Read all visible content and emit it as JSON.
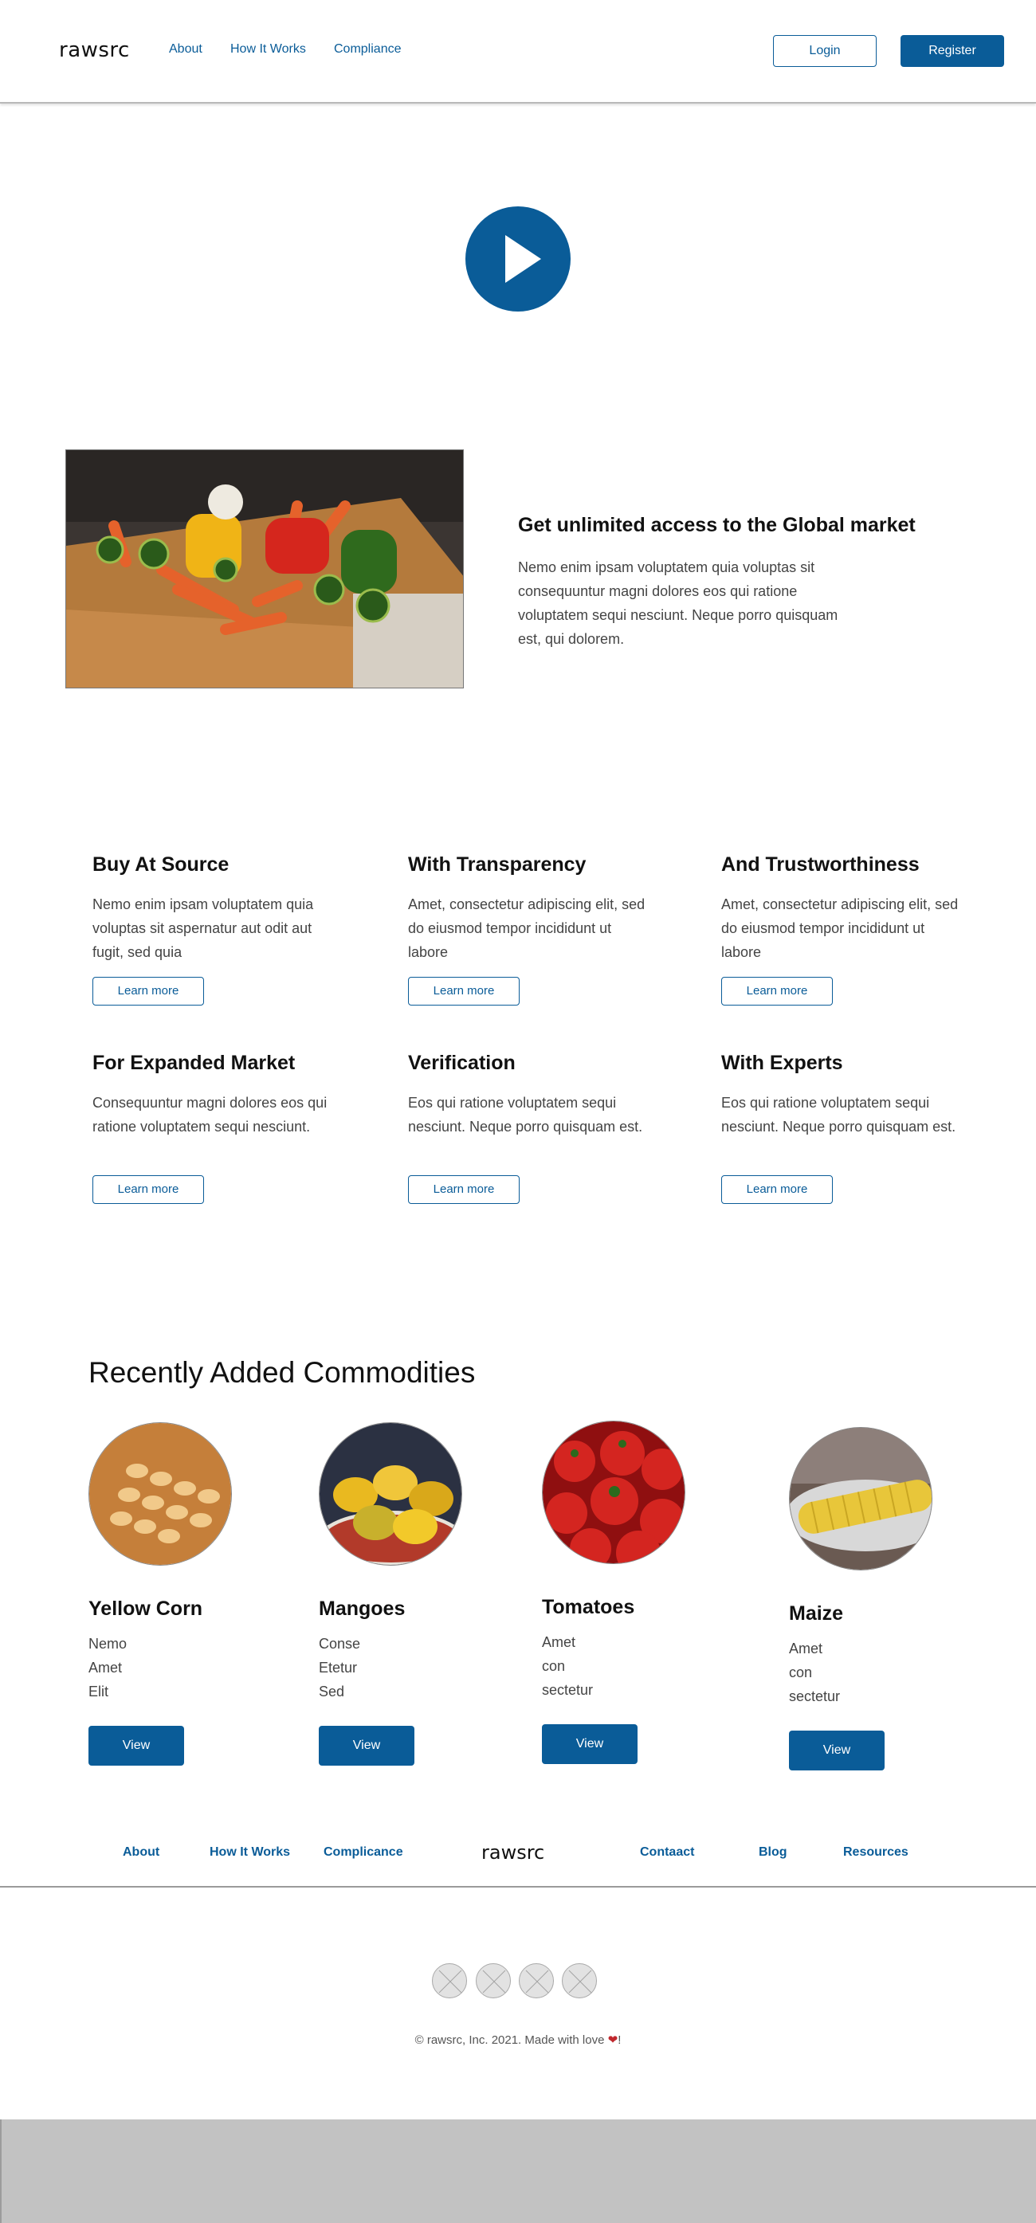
{
  "header": {
    "logo": "rawsrc",
    "nav": [
      "About",
      "How It Works",
      "Compliance"
    ],
    "login_label": "Login",
    "register_label": "Register"
  },
  "hero": {
    "title": "Get unlimited access to the Global market",
    "text": "Nemo enim ipsam voluptatem quia voluptas sit consequuntur magni dolores eos qui ratione voluptatem sequi nesciunt. Neque porro quisquam est, qui dolorem."
  },
  "features": [
    {
      "title": "Buy At Source",
      "text": "Nemo enim ipsam voluptatem quia voluptas sit aspernatur aut odit aut fugit, sed quia",
      "button": "Learn more"
    },
    {
      "title": "With Transparency",
      "text": "Amet, consectetur adipiscing elit, sed do eiusmod tempor incididunt ut labore",
      "button": "Learn more"
    },
    {
      "title": "And Trustworthiness",
      "text": "Amet, consectetur adipiscing elit, sed do eiusmod tempor incididunt ut labore",
      "button": "Learn more"
    },
    {
      "title": "For Expanded Market",
      "text": "Consequuntur magni dolores eos qui ratione voluptatem sequi nesciunt.",
      "button": "Learn more"
    },
    {
      "title": "Verification",
      "text": "Eos qui ratione voluptatem sequi nesciunt. Neque porro quisquam est.",
      "button": "Learn more"
    },
    {
      "title": "With Experts",
      "text": "Eos qui ratione voluptatem sequi nesciunt. Neque porro quisquam est.",
      "button": "Learn more"
    }
  ],
  "commodities": {
    "title": "Recently Added Commodities",
    "items": [
      {
        "name": "Yellow Corn",
        "lines": [
          "Nemo",
          "Amet",
          "Elit"
        ],
        "button": "View"
      },
      {
        "name": "Mangoes",
        "lines": [
          "Conse",
          "Etetur",
          "Sed"
        ],
        "button": "View"
      },
      {
        "name": "Tomatoes",
        "lines": [
          "Amet",
          "con",
          "sectetur"
        ],
        "button": "View"
      },
      {
        "name": "Maize",
        "lines": [
          "Amet",
          "con",
          "sectetur"
        ],
        "button": "View"
      }
    ]
  },
  "footer": {
    "links_left": [
      "About",
      "How It Works",
      "Complicance"
    ],
    "logo": "rawsrc",
    "links_right": [
      "Contaact",
      "Blog",
      "Resources"
    ],
    "copyright": "© rawsrc, Inc. 2021. Made with love",
    "copyright_end": "!"
  },
  "colors": {
    "brand": "#0a5c98"
  }
}
